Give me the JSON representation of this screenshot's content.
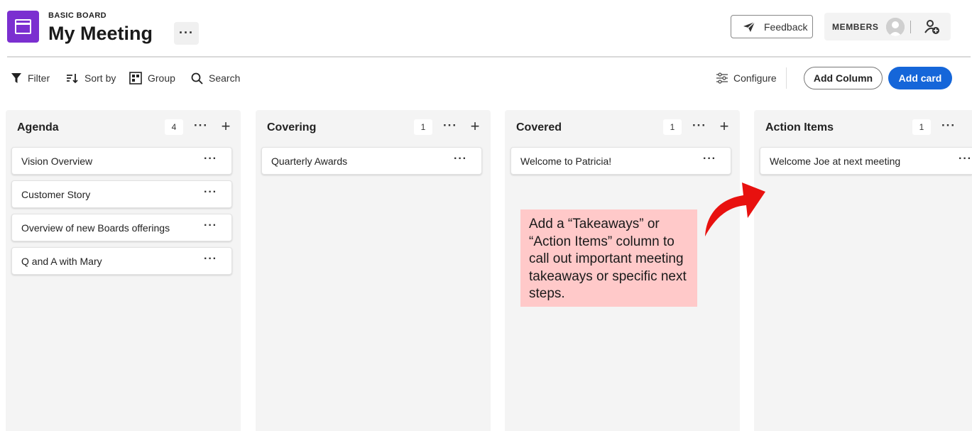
{
  "header": {
    "board_kind": "BASIC BOARD",
    "title": "My Meeting",
    "more_label": "···",
    "feedback_label": "Feedback",
    "members_label": "MEMBERS",
    "icons": {
      "board": "board-icon",
      "feedback": "send-icon",
      "avatar": "avatar-icon",
      "add_member": "add-member-icon"
    },
    "brand_color": "#7b2fd0"
  },
  "toolbar": {
    "filter_label": "Filter",
    "sort_label": "Sort by",
    "group_label": "Group",
    "search_label": "Search",
    "configure_label": "Configure",
    "add_column_label": "Add Column",
    "add_card_label": "Add card",
    "accent_color": "#1566d9"
  },
  "columns": [
    {
      "title": "Agenda",
      "count": "4",
      "cards": [
        {
          "title": "Vision Overview"
        },
        {
          "title": "Customer Story"
        },
        {
          "title": "Overview of new Boards offerings"
        },
        {
          "title": "Q and A with Mary"
        }
      ]
    },
    {
      "title": "Covering",
      "count": "1",
      "cards": [
        {
          "title": "Quarterly Awards"
        }
      ]
    },
    {
      "title": "Covered",
      "count": "1",
      "cards": [
        {
          "title": "Welcome to Patricia!"
        }
      ]
    },
    {
      "title": "Action Items",
      "count": "1",
      "cards": [
        {
          "title": "Welcome Joe at next meeting"
        }
      ]
    }
  ],
  "annotation": {
    "text": "Add a “Takeaways” or “Action Items” column to call out important meeting takeaways or specific next steps.",
    "background_color": "#ffc9c9",
    "arrow_color": "#e8110f"
  }
}
